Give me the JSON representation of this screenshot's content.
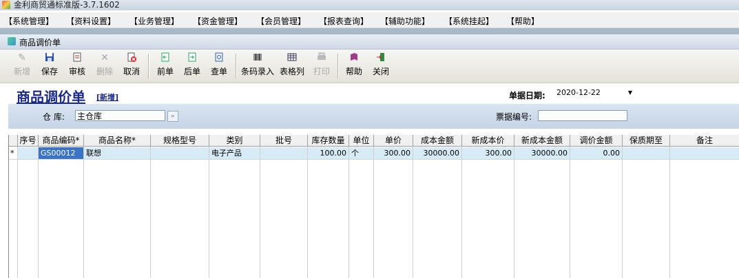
{
  "window": {
    "title": "金利商贸通标准版-3.7.1602"
  },
  "menu": [
    "【系统管理】",
    "【资料设置】",
    "【业务管理】",
    "【资金管理】",
    "【会员管理】",
    "【报表查询】",
    "【辅助功能】",
    "【系统挂起】",
    "【帮助】"
  ],
  "child_window": {
    "title": "商品调价单"
  },
  "toolbar": {
    "new": "新增",
    "save": "保存",
    "audit": "审核",
    "delete": "删除",
    "cancel": "取消",
    "prev": "前单",
    "next": "后单",
    "query": "查单",
    "barcode": "条码录入",
    "columns": "表格列",
    "print": "打印",
    "help": "帮助",
    "close": "关闭"
  },
  "form": {
    "title": "商品调价单",
    "mode": "[新增]",
    "date_label": "单据日期:",
    "date_value": "2020-12-22",
    "warehouse_label": "仓  库:",
    "warehouse_value": "主仓库",
    "ticket_label": "票据编号:",
    "ticket_value": ""
  },
  "table": {
    "columns": [
      "序号",
      "商品编码*",
      "商品名称*",
      "规格型号",
      "类别",
      "批号",
      "库存数量",
      "单位",
      "单价",
      "成本金额",
      "新成本价",
      "新成本金额",
      "调价金额",
      "保质期至",
      "备注"
    ],
    "row_marker": "*",
    "rows": [
      [
        "",
        "GS00012",
        "联想",
        "",
        "电子产品",
        "",
        "100.00",
        "个",
        "300.00",
        "30000.00",
        "300.00",
        "30000.00",
        "0.00",
        "",
        ""
      ]
    ]
  }
}
